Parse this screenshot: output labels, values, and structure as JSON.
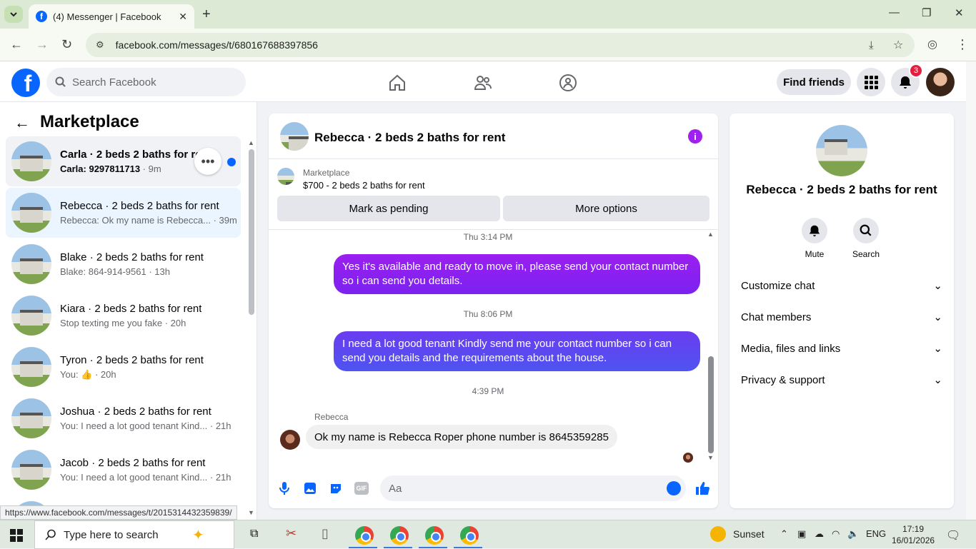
{
  "browser": {
    "tab_title": "(4) Messenger | Facebook",
    "url": "facebook.com/messages/t/680167688397856",
    "status_url": "https://www.facebook.com/messages/t/2015314432359839/"
  },
  "fb_header": {
    "logo": "f",
    "search_placeholder": "Search Facebook",
    "find_friends": "Find friends",
    "notification_count": "3"
  },
  "left": {
    "title": "Marketplace",
    "conversations": [
      {
        "name": "Carla · 2 beds 2 baths for rent",
        "preview": "Carla: 9297811713",
        "time": "· 9m"
      },
      {
        "name": "Rebecca · 2 beds 2 baths for rent",
        "preview": "Rebecca: Ok my name is Rebecca...",
        "time": "· 39m"
      },
      {
        "name": "Blake · 2 beds 2 baths for rent",
        "preview": "Blake: 864-914-9561",
        "time": "· 13h"
      },
      {
        "name": "Kiara · 2 beds 2 baths for rent",
        "preview": "Stop texting me you fake",
        "time": "· 20h"
      },
      {
        "name": "Tyron · 2 beds 2 baths for rent",
        "preview": "You: 👍",
        "time": "· 20h"
      },
      {
        "name": "Joshua · 2 beds 2 baths for rent",
        "preview": "You: I need a lot good tenant Kind...",
        "time": "· 21h"
      },
      {
        "name": "Jacob · 2 beds 2 baths for rent",
        "preview": "You: I need a lot good tenant Kind...",
        "time": "· 21h"
      }
    ]
  },
  "chat": {
    "title": "Rebecca · 2 beds 2 baths for rent",
    "marketplace_label": "Marketplace",
    "listing": "$700 - 2 beds 2 baths for rent",
    "mark_pending": "Mark as pending",
    "more_options": "More options",
    "messages": [
      {
        "timestamp": "Thu 3:14 PM",
        "text": "Yes it's available and ready to move in, please send your contact number so i can send you details."
      },
      {
        "timestamp": "Thu 8:06 PM",
        "text": "I need a lot good tenant Kindly send me your contact number so i can send you details and the requirements about the house."
      },
      {
        "timestamp": "4:39 PM",
        "sender": "Rebecca",
        "text": "Ok my name is Rebecca Roper phone number is 8645359285"
      }
    ],
    "input_placeholder": "Aa",
    "gif_label": "GIF"
  },
  "right": {
    "name": "Rebecca · 2 beds 2 baths for rent",
    "mute": "Mute",
    "search": "Search",
    "options": [
      "Customize chat",
      "Chat members",
      "Media, files and links",
      "Privacy & support"
    ]
  },
  "taskbar": {
    "search_placeholder": "Type here to search",
    "weather": "Sunset",
    "lang": "ENG",
    "time": "17:19",
    "date": "16/01/2026"
  },
  "colors": {
    "brand": "#0866ff",
    "bubble_purple": "#9b1ff0",
    "bubble_blue": "#4f54f0"
  }
}
